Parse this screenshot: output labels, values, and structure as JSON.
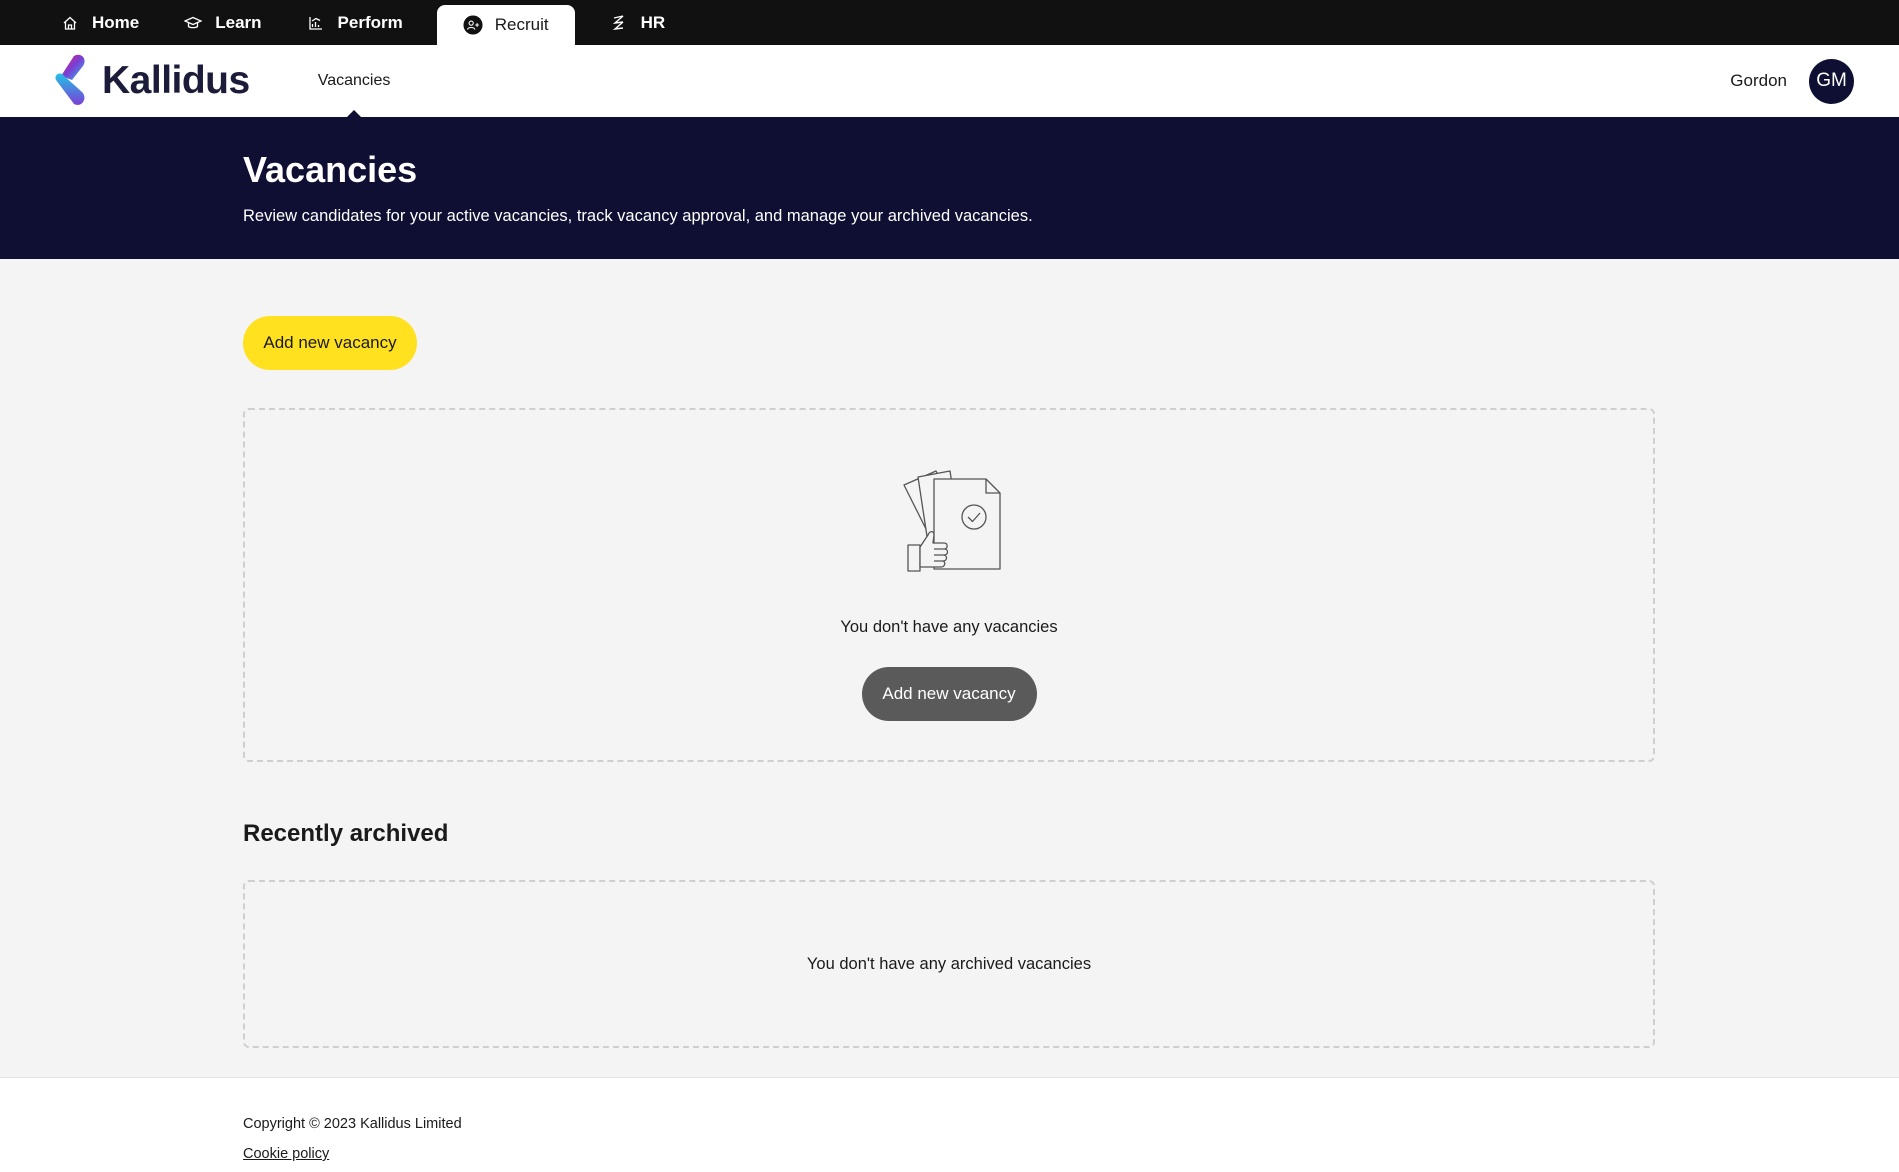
{
  "topnav": {
    "items": [
      {
        "label": "Home",
        "icon": "home-icon"
      },
      {
        "label": "Learn",
        "icon": "graduation-cap-icon"
      },
      {
        "label": "Perform",
        "icon": "chart-icon"
      },
      {
        "label": "Recruit",
        "icon": "recruit-icon",
        "active": true
      },
      {
        "label": "HR",
        "icon": "hr-icon"
      }
    ]
  },
  "header": {
    "logo_text": "Kallidus",
    "subnav_tab": "Vacancies",
    "username": "Gordon",
    "avatar_initials": "GM"
  },
  "hero": {
    "title": "Vacancies",
    "description": "Review candidates for your active vacancies, track vacancy approval, and manage your archived vacancies."
  },
  "main": {
    "add_button_label": "Add new vacancy",
    "empty_text": "You don't have any vacancies",
    "empty_add_button_label": "Add new vacancy",
    "archived_title": "Recently archived",
    "archived_empty_text": "You don't have any archived vacancies"
  },
  "footer": {
    "copyright": "Copyright © 2023 Kallidus Limited",
    "cookie_policy": "Cookie policy"
  },
  "colors": {
    "nav_bg": "#111111",
    "hero_bg": "#0e0f33",
    "primary_button": "#ffe11f",
    "secondary_button": "#5a5a5a"
  }
}
